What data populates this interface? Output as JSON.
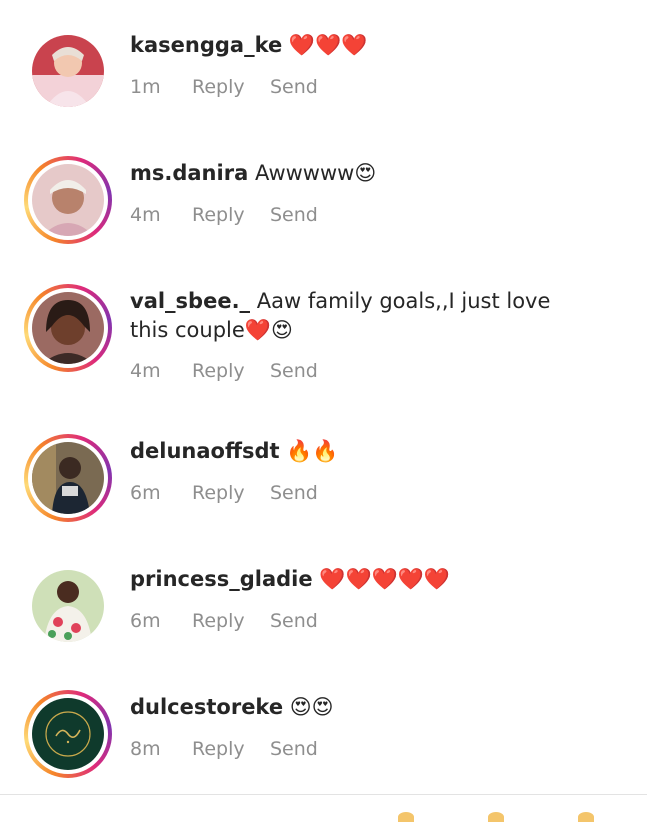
{
  "comments": [
    {
      "username": "kasengga_ke",
      "text": "",
      "emoji": "❤️❤️❤️",
      "time": "1m",
      "reply_label": "Reply",
      "send_label": "Send",
      "has_story": false
    },
    {
      "username": "ms.danira",
      "text": "Awwwww",
      "emoji": "😍",
      "time": "4m",
      "reply_label": "Reply",
      "send_label": "Send",
      "has_story": true
    },
    {
      "username": "val_sbee._",
      "text": "Aaw family goals,,I just love this couple",
      "emoji": "❤️😍",
      "time": "4m",
      "reply_label": "Reply",
      "send_label": "Send",
      "has_story": true
    },
    {
      "username": "delunaoffsdt",
      "text": "",
      "emoji": "🔥🔥",
      "time": "6m",
      "reply_label": "Reply",
      "send_label": "Send",
      "has_story": true
    },
    {
      "username": "princess_gladie",
      "text": "",
      "emoji": "❤️❤️❤️❤️❤️",
      "time": "6m",
      "reply_label": "Reply",
      "send_label": "Send",
      "has_story": false
    },
    {
      "username": "dulcestoreke",
      "text": "",
      "emoji": "😍😍",
      "time": "8m",
      "reply_label": "Reply",
      "send_label": "Send",
      "has_story": true
    }
  ],
  "colors": {
    "text": "#262626",
    "meta": "#8e8e8e",
    "heart": "#e0242f",
    "story_ring_start": "#f58529",
    "story_ring_mid": "#dd2a7b",
    "story_ring_end": "#8134af"
  }
}
